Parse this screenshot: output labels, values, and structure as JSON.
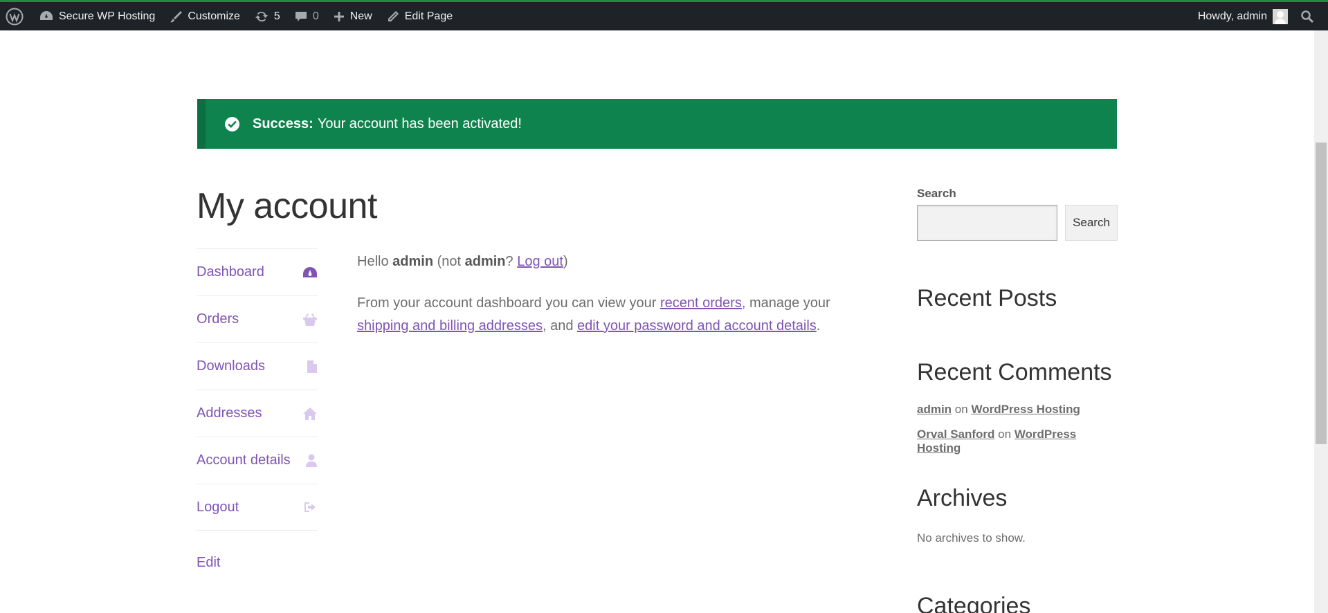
{
  "admin_bar": {
    "site_name": "Secure WP Hosting",
    "customize": "Customize",
    "updates_count": "5",
    "comments_count": "0",
    "new": "New",
    "edit_page": "Edit Page",
    "howdy": "Howdy, admin"
  },
  "notice": {
    "label": "Success:",
    "message": "Your account has been activated!"
  },
  "page": {
    "title": "My account"
  },
  "account_nav": {
    "items": [
      {
        "label": "Dashboard",
        "icon": "dashboard-icon"
      },
      {
        "label": "Orders",
        "icon": "basket-icon"
      },
      {
        "label": "Downloads",
        "icon": "file-icon"
      },
      {
        "label": "Addresses",
        "icon": "home-icon"
      },
      {
        "label": "Account details",
        "icon": "user-icon"
      },
      {
        "label": "Logout",
        "icon": "sign-out-icon"
      }
    ],
    "edit": "Edit"
  },
  "content": {
    "hello": "Hello ",
    "user": "admin",
    "not": " (not ",
    "user2": "admin",
    "q": "? ",
    "logout": "Log out",
    "close": ")",
    "intro": "From your account dashboard you can view your ",
    "recent_orders": "recent orders",
    "manage": ", manage your ",
    "addresses": "shipping and billing addresses",
    "and": ", and ",
    "details": "edit your password and account details",
    "end": "."
  },
  "sidebar": {
    "search_label": "Search",
    "search_button": "Search",
    "recent_posts": "Recent Posts",
    "recent_comments": "Recent Comments",
    "comments": [
      {
        "author": "admin",
        "on": "on",
        "post": "WordPress Hosting"
      },
      {
        "author": "Orval Sanford",
        "on": "on",
        "post": "WordPress Hosting"
      }
    ],
    "archives": "Archives",
    "no_archives": "No archives to show.",
    "categories": "Categories"
  }
}
